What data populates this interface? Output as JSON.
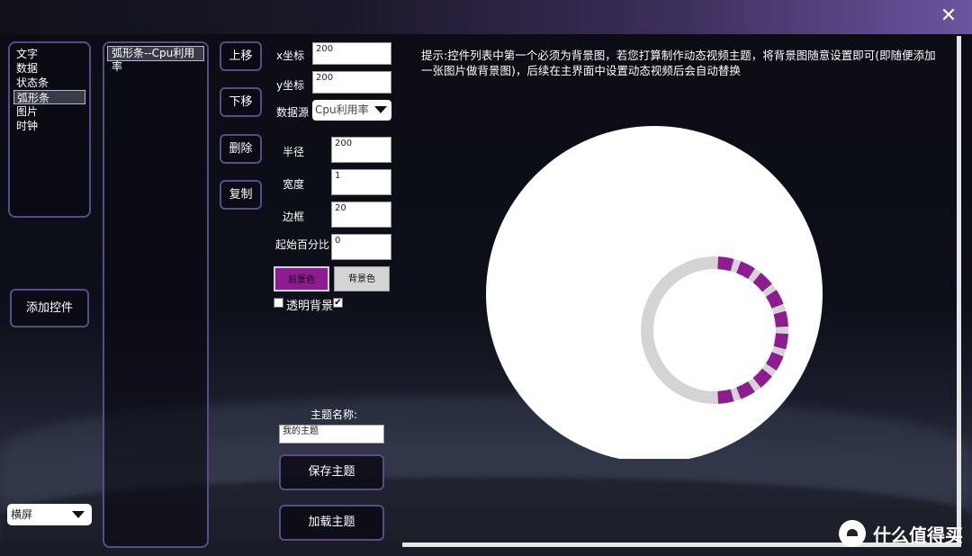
{
  "window": {
    "close_glyph": "✕"
  },
  "types": [
    "文字",
    "数据",
    "状态条",
    "弧形条",
    "图片",
    "时钟"
  ],
  "type_selected_index": 3,
  "controls": [
    "弧形条--Cpu利用率"
  ],
  "buttons": {
    "add": "添加控件",
    "up": "上移",
    "down": "下移",
    "delete": "删除",
    "copy": "复制",
    "save_theme": "保存主题",
    "load_theme": "加载主题"
  },
  "orientation": {
    "value": "横屏"
  },
  "props": {
    "x_label": "x坐标",
    "x_value": "200",
    "y_label": "y坐标",
    "y_value": "200",
    "source_label": "数据源",
    "source_value": "Cpu利用率",
    "radius_label": "半径",
    "radius_value": "200",
    "width_label": "宽度",
    "width_value": "1",
    "border_label": "边框",
    "border_value": "20",
    "start_pct_label": "起始百分比",
    "start_pct_value": "0",
    "fg_color_label": "前景色",
    "bg_color_label": "背景色",
    "transparent_bg_label": "透明背景",
    "transparent_bg_checked": false,
    "segmented_checked": true
  },
  "theme": {
    "name_label": "主题名称:",
    "name_value": "我的主题"
  },
  "hint": "提示:控件列表中第一个必须为背景图，若您打算制作动态视频主题，将背景图随意设置即可(即随便添加一张图片做背景图)，后续在主界面中设置动态视频后会自动替换",
  "colors": {
    "foreground": "#8c1c90",
    "background": "#d4d4d4",
    "canvas": "#ffffff"
  },
  "arc": {
    "start_percent": 0,
    "value_percent": 50,
    "segments": 20
  },
  "watermark": {
    "text": "什么值得买",
    "icon": "smzdm-logo-icon"
  }
}
